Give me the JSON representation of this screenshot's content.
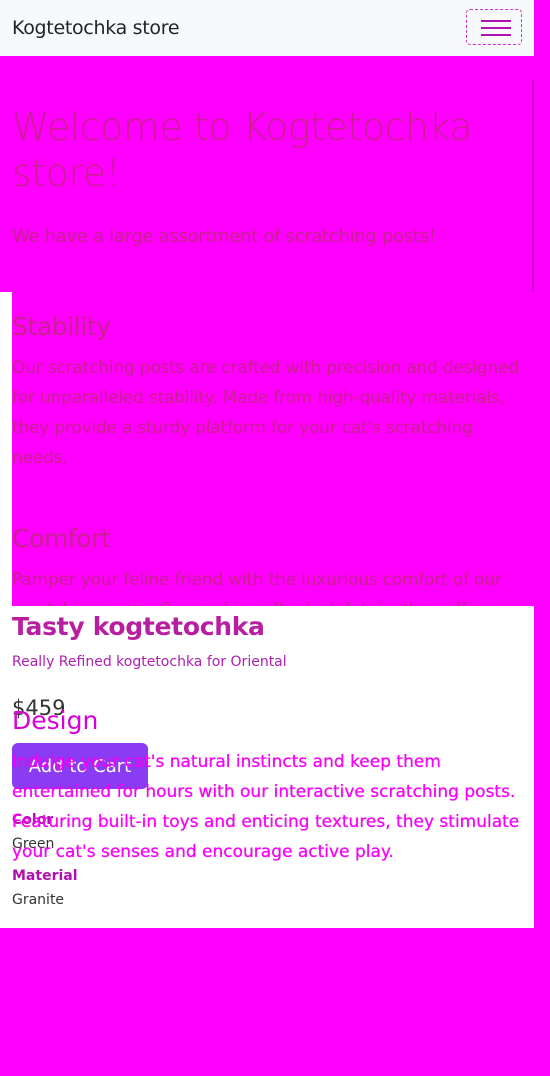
{
  "navbar": {
    "brand": "Kogtetochka store",
    "toggler_icon": "hamburger-menu-icon"
  },
  "hero": {
    "title": "Welcome to Kogtetochka store!",
    "subtitle": "We have a large assortment of scratching posts!"
  },
  "features": [
    {
      "title": "Stability",
      "text": "Our scratching posts are crafted with precision and designed for unparalleled stability. Made from high-quality materials, they provide a sturdy platform for your cat's scratching needs."
    },
    {
      "title": "Comfort",
      "text": "Pamper your feline friend with the luxurious comfort of our scratching posts. Covered in soft, plush fabric, they offer a cozy retreat for your cat to relax and unwind."
    },
    {
      "title": "Design",
      "text": "Indulge your cat's natural instincts and keep them entertained for hours with our interactive scratching posts. Featuring built-in toys and enticing textures, they stimulate your cat's senses and encourage active play."
    }
  ],
  "product": {
    "name": "Tasty kogtetochka",
    "description": "Really Refined kogtetochka for Oriental",
    "price": "$459",
    "add_to_cart": "Add to Cart",
    "specs": [
      {
        "label": "Color",
        "value": "Green"
      },
      {
        "label": "Material",
        "value": "Granite"
      }
    ]
  },
  "colors": {
    "page_background": "#ff00ff",
    "navbar_background": "#f8f9fa",
    "button": "#8a3cf2",
    "product_card": "#ffffff"
  }
}
